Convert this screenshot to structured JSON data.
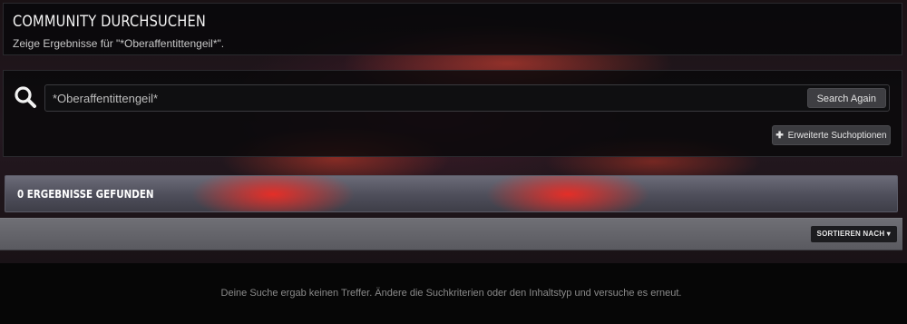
{
  "header": {
    "title": "COMMUNITY DURCHSUCHEN",
    "subtitle": "Zeige Ergebnisse für \"*Oberaffentittengeil*\"."
  },
  "search": {
    "value": "*Oberaffentittengeil*",
    "search_again_label": "Search Again",
    "advanced_label": "Erweiterte Suchoptionen",
    "icon": "search-icon"
  },
  "results": {
    "title": "0 ERGEBNISSE GEFUNDEN",
    "sort_label": "SORTIEREN NACH"
  },
  "empty": {
    "message": "Deine Suche ergab keinen Treffer. Ändere die Suchkriterien oder den Inhaltstyp und versuche es erneut."
  },
  "colors": {
    "accent_red": "#e8332a",
    "panel_dark": "#0a0a0c"
  }
}
